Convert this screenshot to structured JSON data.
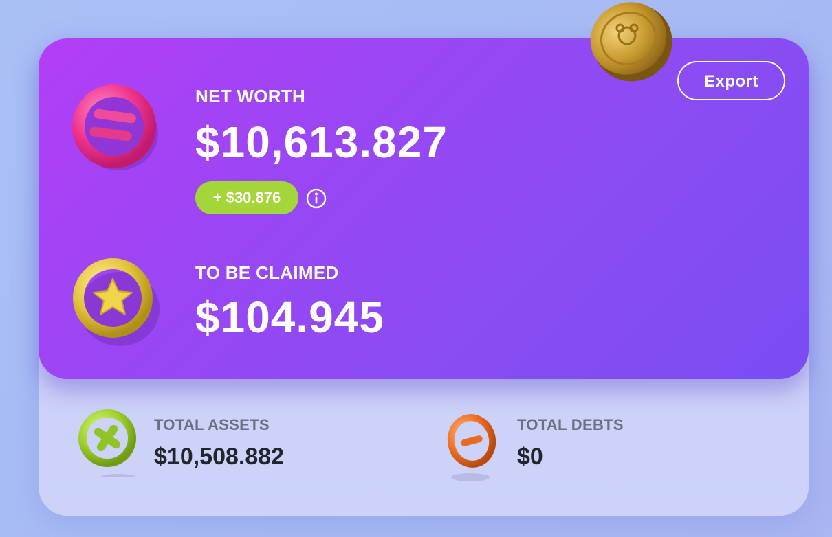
{
  "header": {
    "export_label": "Export"
  },
  "net_worth": {
    "label": "NET WORTH",
    "value": "$10,613.827",
    "change": "+ $30.876",
    "icon": "pink-equals-ring-icon"
  },
  "to_be_claimed": {
    "label": "TO BE CLAIMED",
    "value": "$104.945",
    "icon": "yellow-star-ring-icon"
  },
  "total_assets": {
    "label": "TOTAL ASSETS",
    "value": "$10,508.882",
    "icon": "green-plus-ring-icon"
  },
  "total_debts": {
    "label": "TOTAL DEBTS",
    "value": "$0",
    "icon": "orange-minus-ring-icon"
  },
  "decor": {
    "coin_icon": "gold-coin-icon"
  },
  "colors": {
    "card_gradient_start": "#b33ef6",
    "card_gradient_end": "#7a4cf2",
    "positive_change": "#a4d63a",
    "assets_icon": "#9ed12c",
    "debts_icon": "#ef6f25"
  }
}
